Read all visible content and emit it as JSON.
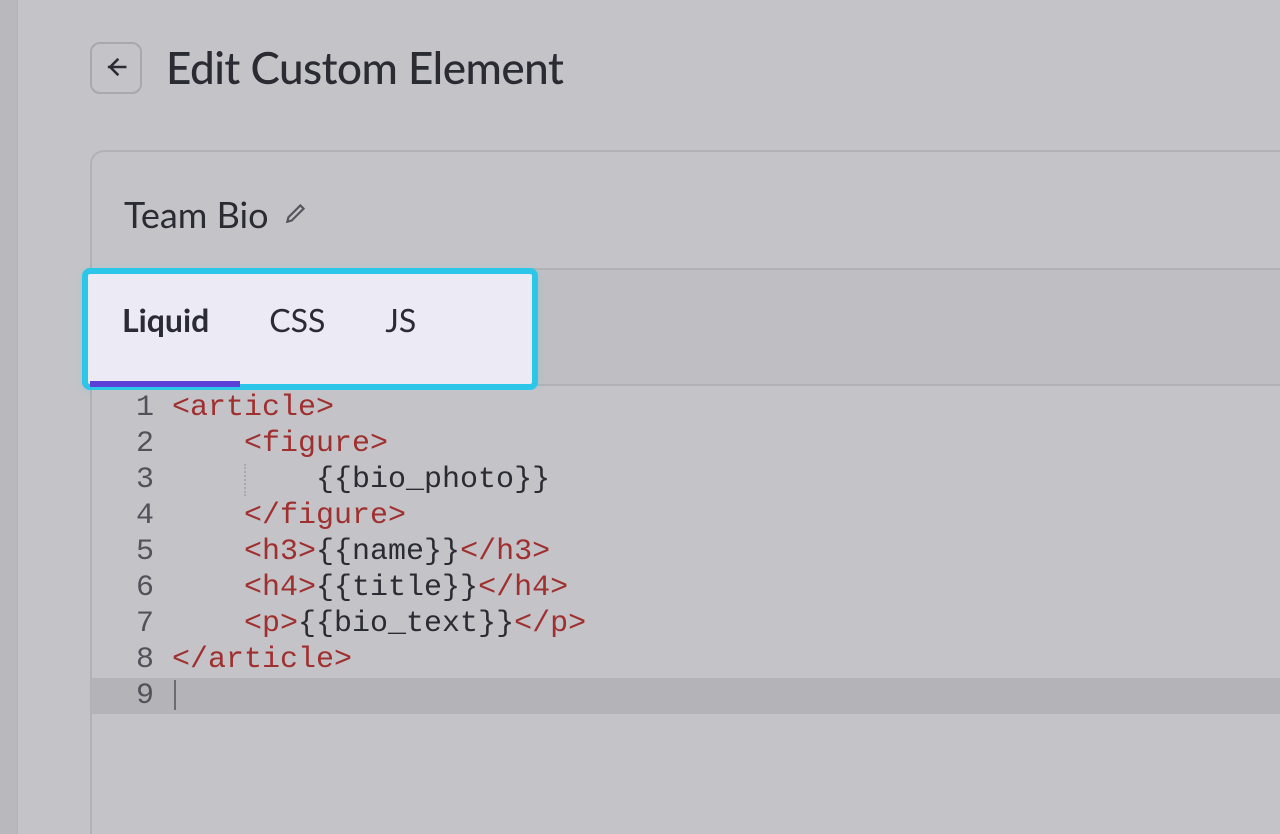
{
  "header": {
    "title": "Edit Custom Element"
  },
  "panel": {
    "name": "Team Bio"
  },
  "tabs": [
    {
      "label": "Liquid",
      "active": true
    },
    {
      "label": "CSS",
      "active": false
    },
    {
      "label": "JS",
      "active": false
    }
  ],
  "code": {
    "lines": [
      {
        "n": 1,
        "indent": 0,
        "tokens": [
          {
            "t": "tag",
            "v": "<article>"
          }
        ]
      },
      {
        "n": 2,
        "indent": 1,
        "tokens": [
          {
            "t": "tag",
            "v": "<figure>"
          }
        ]
      },
      {
        "n": 3,
        "indent": 2,
        "guide": true,
        "tokens": [
          {
            "t": "plain",
            "v": "{{bio_photo}}"
          }
        ]
      },
      {
        "n": 4,
        "indent": 1,
        "tokens": [
          {
            "t": "tag",
            "v": "</figure>"
          }
        ]
      },
      {
        "n": 5,
        "indent": 1,
        "tokens": [
          {
            "t": "tag",
            "v": "<h3>"
          },
          {
            "t": "plain",
            "v": "{{name}}"
          },
          {
            "t": "tag",
            "v": "</h3>"
          }
        ]
      },
      {
        "n": 6,
        "indent": 1,
        "tokens": [
          {
            "t": "tag",
            "v": "<h4>"
          },
          {
            "t": "plain",
            "v": "{{title}}"
          },
          {
            "t": "tag",
            "v": "</h4>"
          }
        ]
      },
      {
        "n": 7,
        "indent": 1,
        "tokens": [
          {
            "t": "tag",
            "v": "<p>"
          },
          {
            "t": "plain",
            "v": "{{bio_text}}"
          },
          {
            "t": "tag",
            "v": "</p>"
          }
        ]
      },
      {
        "n": 8,
        "indent": 0,
        "tokens": [
          {
            "t": "tag",
            "v": "</article>"
          }
        ]
      },
      {
        "n": 9,
        "indent": 0,
        "current": true,
        "tokens": []
      }
    ]
  },
  "colors": {
    "accent": "#5b3fd9",
    "highlight": "#2cc6e8",
    "tag": "#a02f2f"
  }
}
